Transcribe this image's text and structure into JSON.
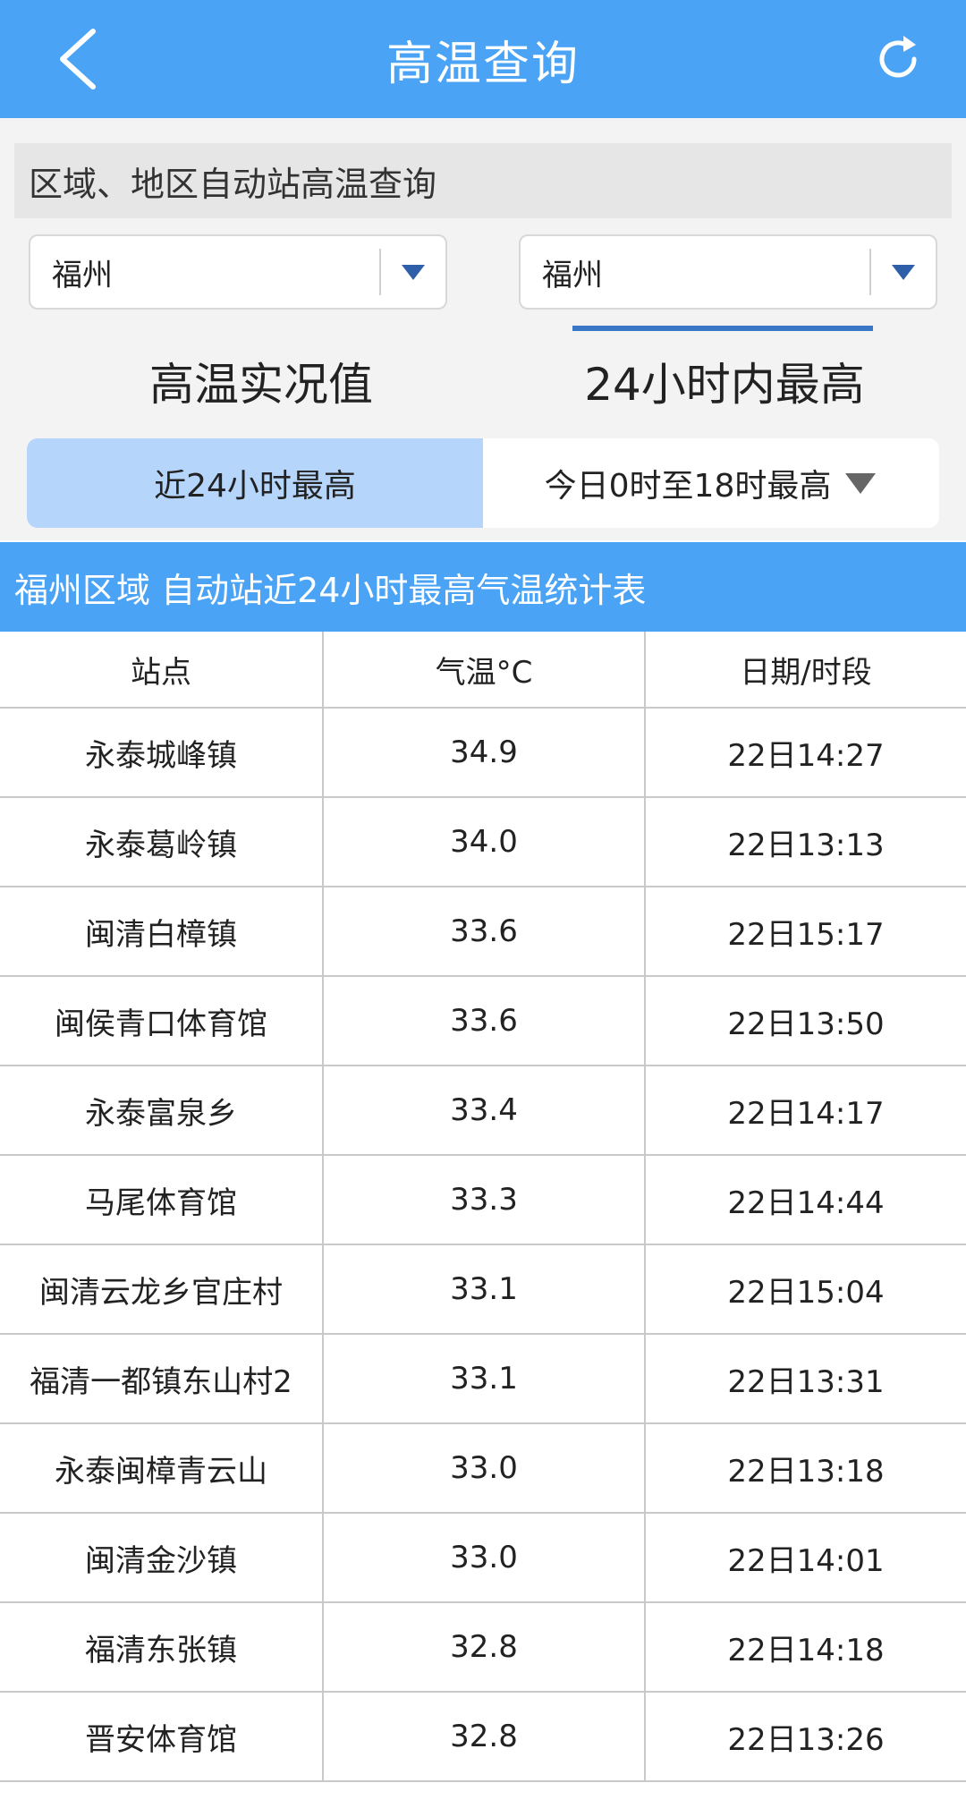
{
  "header": {
    "title": "高温查询"
  },
  "filter": {
    "section_label": "区域、地区自动站高温查询",
    "region_select_value": "福州",
    "area_select_value": "福州"
  },
  "tabs": [
    {
      "label": "高温实况值",
      "active": false
    },
    {
      "label": "24小时内最高",
      "active": true
    }
  ],
  "subtabs": [
    {
      "label": "近24小时最高",
      "active": true
    },
    {
      "label": "今日0时至18时最高",
      "active": false
    }
  ],
  "table": {
    "title": "福州区域 自动站近24小时最高气温统计表",
    "columns": [
      "站点",
      "气温°C",
      "日期/时段"
    ],
    "rows": [
      [
        "永泰城峰镇",
        "34.9",
        "22日14:27"
      ],
      [
        "永泰葛岭镇",
        "34.0",
        "22日13:13"
      ],
      [
        "闽清白樟镇",
        "33.6",
        "22日15:17"
      ],
      [
        "闽侯青口体育馆",
        "33.6",
        "22日13:50"
      ],
      [
        "永泰富泉乡",
        "33.4",
        "22日14:17"
      ],
      [
        "马尾体育馆",
        "33.3",
        "22日14:44"
      ],
      [
        "闽清云龙乡官庄村",
        "33.1",
        "22日15:04"
      ],
      [
        "福清一都镇东山村2",
        "33.1",
        "22日13:31"
      ],
      [
        "永泰闽樟青云山",
        "33.0",
        "22日13:18"
      ],
      [
        "闽清金沙镇",
        "33.0",
        "22日14:01"
      ],
      [
        "福清东张镇",
        "32.8",
        "22日14:18"
      ],
      [
        "晋安体育馆",
        "32.8",
        "22日13:26"
      ]
    ]
  },
  "colors": {
    "header_bg": "#4aa3f4",
    "active_subtab_bg": "#b6d5fb",
    "tab_underline": "#3a78c7",
    "select_arrow": "#2f5fa8"
  },
  "icons": {
    "back": "chevron-left-icon",
    "refresh": "refresh-icon",
    "dropdown": "triangle-down-icon"
  }
}
